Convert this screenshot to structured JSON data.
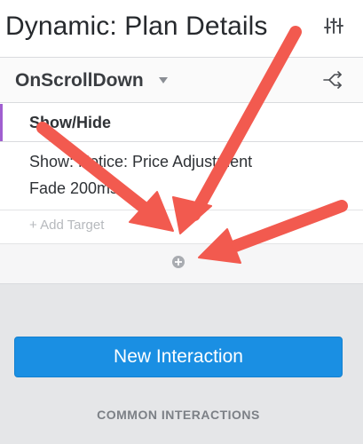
{
  "header": {
    "title": "Dynamic: Plan Details",
    "settings_icon": "sliders-icon"
  },
  "trigger": {
    "label": "OnScrollDown",
    "caret_icon": "caret-down-icon",
    "action_icon": "shuffle-icon"
  },
  "action": {
    "label": "Show/Hide",
    "accent_color": "#a05fd0",
    "target_line1": "Show: Notice: Price Adjustment",
    "target_line2": "Fade 200ms"
  },
  "add_target": {
    "label": "+ Add Target"
  },
  "add_action": {
    "icon": "plus-circle-icon"
  },
  "new_interaction": {
    "label": "New Interaction",
    "color": "#1a8fe3"
  },
  "section": {
    "common_label": "COMMON INTERACTIONS"
  },
  "annotation": {
    "arrow_color": "#f25a4f"
  }
}
